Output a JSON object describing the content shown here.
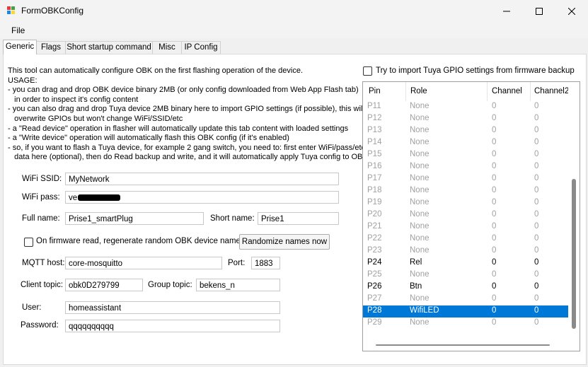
{
  "window": {
    "title": "FormOBKConfig"
  },
  "menu": {
    "file": "File"
  },
  "tabs": [
    "Generic",
    "Flags",
    "Short startup command",
    "Misc",
    "IP Config"
  ],
  "info_text": "This tool can automatically configure OBK on the first flashing operation of the device.\nUSAGE:\n- you can drag and drop OBK device binary 2MB (or only config downloaded from Web App Flash tab)\n   in order to inspect it's config content\n- you can also drag and drop Tuya device 2MB binary here to import GPIO settings (if possible), this will\n   overwrite GPIOs but won't change WiFi/SSID/etc\n- a \"Read device\" operation in flasher will automatically update this tab content with loaded settings\n- a \"Write device\" operation will automatically flash this OBK config (if it's enabled)\n- so, if you want to flash a Tuya device, for example 2 gang switch, you need to: first enter WiFi/pass/etc\n   data here (optional), then do Read backup and write, and it will automatically apply Tuya config to OBK",
  "form": {
    "wifi_ssid_label": "WiFi SSID:",
    "wifi_ssid": "MyNetwork",
    "wifi_pass_label": "WiFi pass:",
    "wifi_pass_visible": "ve",
    "full_name_label": "Full name:",
    "full_name": "Prise1_smartPlug",
    "short_name_label": "Short name:",
    "short_name": "Prise1",
    "regen_label": "On firmware read, regenerate random OBK device names",
    "regen_checked": false,
    "randomize_button": "Randomize names now",
    "mqtt_host_label": "MQTT host:",
    "mqtt_host": "core-mosquitto",
    "port_label": "Port:",
    "port": "1883",
    "client_topic_label": "Client topic:",
    "client_topic": "obk0D279799",
    "group_topic_label": "Group topic:",
    "group_topic": "bekens_n",
    "user_label": "User:",
    "user": "homeassistant",
    "password_label": "Password:",
    "password": "qqqqqqqqqq"
  },
  "tuya_import": {
    "label": "Try to import Tuya GPIO settings from firmware backup",
    "checked": false
  },
  "grid": {
    "columns": [
      "Pin",
      "Role",
      "Channel",
      "Channel2"
    ],
    "rows": [
      {
        "pin": "P11",
        "role": "None",
        "ch": "0",
        "ch2": "0",
        "active": false
      },
      {
        "pin": "P12",
        "role": "None",
        "ch": "0",
        "ch2": "0",
        "active": false
      },
      {
        "pin": "P13",
        "role": "None",
        "ch": "0",
        "ch2": "0",
        "active": false
      },
      {
        "pin": "P14",
        "role": "None",
        "ch": "0",
        "ch2": "0",
        "active": false
      },
      {
        "pin": "P15",
        "role": "None",
        "ch": "0",
        "ch2": "0",
        "active": false
      },
      {
        "pin": "P16",
        "role": "None",
        "ch": "0",
        "ch2": "0",
        "active": false
      },
      {
        "pin": "P17",
        "role": "None",
        "ch": "0",
        "ch2": "0",
        "active": false
      },
      {
        "pin": "P18",
        "role": "None",
        "ch": "0",
        "ch2": "0",
        "active": false
      },
      {
        "pin": "P19",
        "role": "None",
        "ch": "0",
        "ch2": "0",
        "active": false
      },
      {
        "pin": "P20",
        "role": "None",
        "ch": "0",
        "ch2": "0",
        "active": false
      },
      {
        "pin": "P21",
        "role": "None",
        "ch": "0",
        "ch2": "0",
        "active": false
      },
      {
        "pin": "P22",
        "role": "None",
        "ch": "0",
        "ch2": "0",
        "active": false
      },
      {
        "pin": "P23",
        "role": "None",
        "ch": "0",
        "ch2": "0",
        "active": false
      },
      {
        "pin": "P24",
        "role": "Rel",
        "ch": "0",
        "ch2": "0",
        "active": true
      },
      {
        "pin": "P25",
        "role": "None",
        "ch": "0",
        "ch2": "0",
        "active": false
      },
      {
        "pin": "P26",
        "role": "Btn",
        "ch": "0",
        "ch2": "0",
        "active": true
      },
      {
        "pin": "P27",
        "role": "None",
        "ch": "0",
        "ch2": "0",
        "active": false
      },
      {
        "pin": "P28",
        "role": "WifiLED",
        "ch": "0",
        "ch2": "0",
        "active": true,
        "selected": true
      },
      {
        "pin": "P29",
        "role": "None",
        "ch": "0",
        "ch2": "0",
        "active": false
      }
    ]
  },
  "colors": {
    "selection": "#0078d7",
    "inactive_text": "#a0a0a0"
  }
}
